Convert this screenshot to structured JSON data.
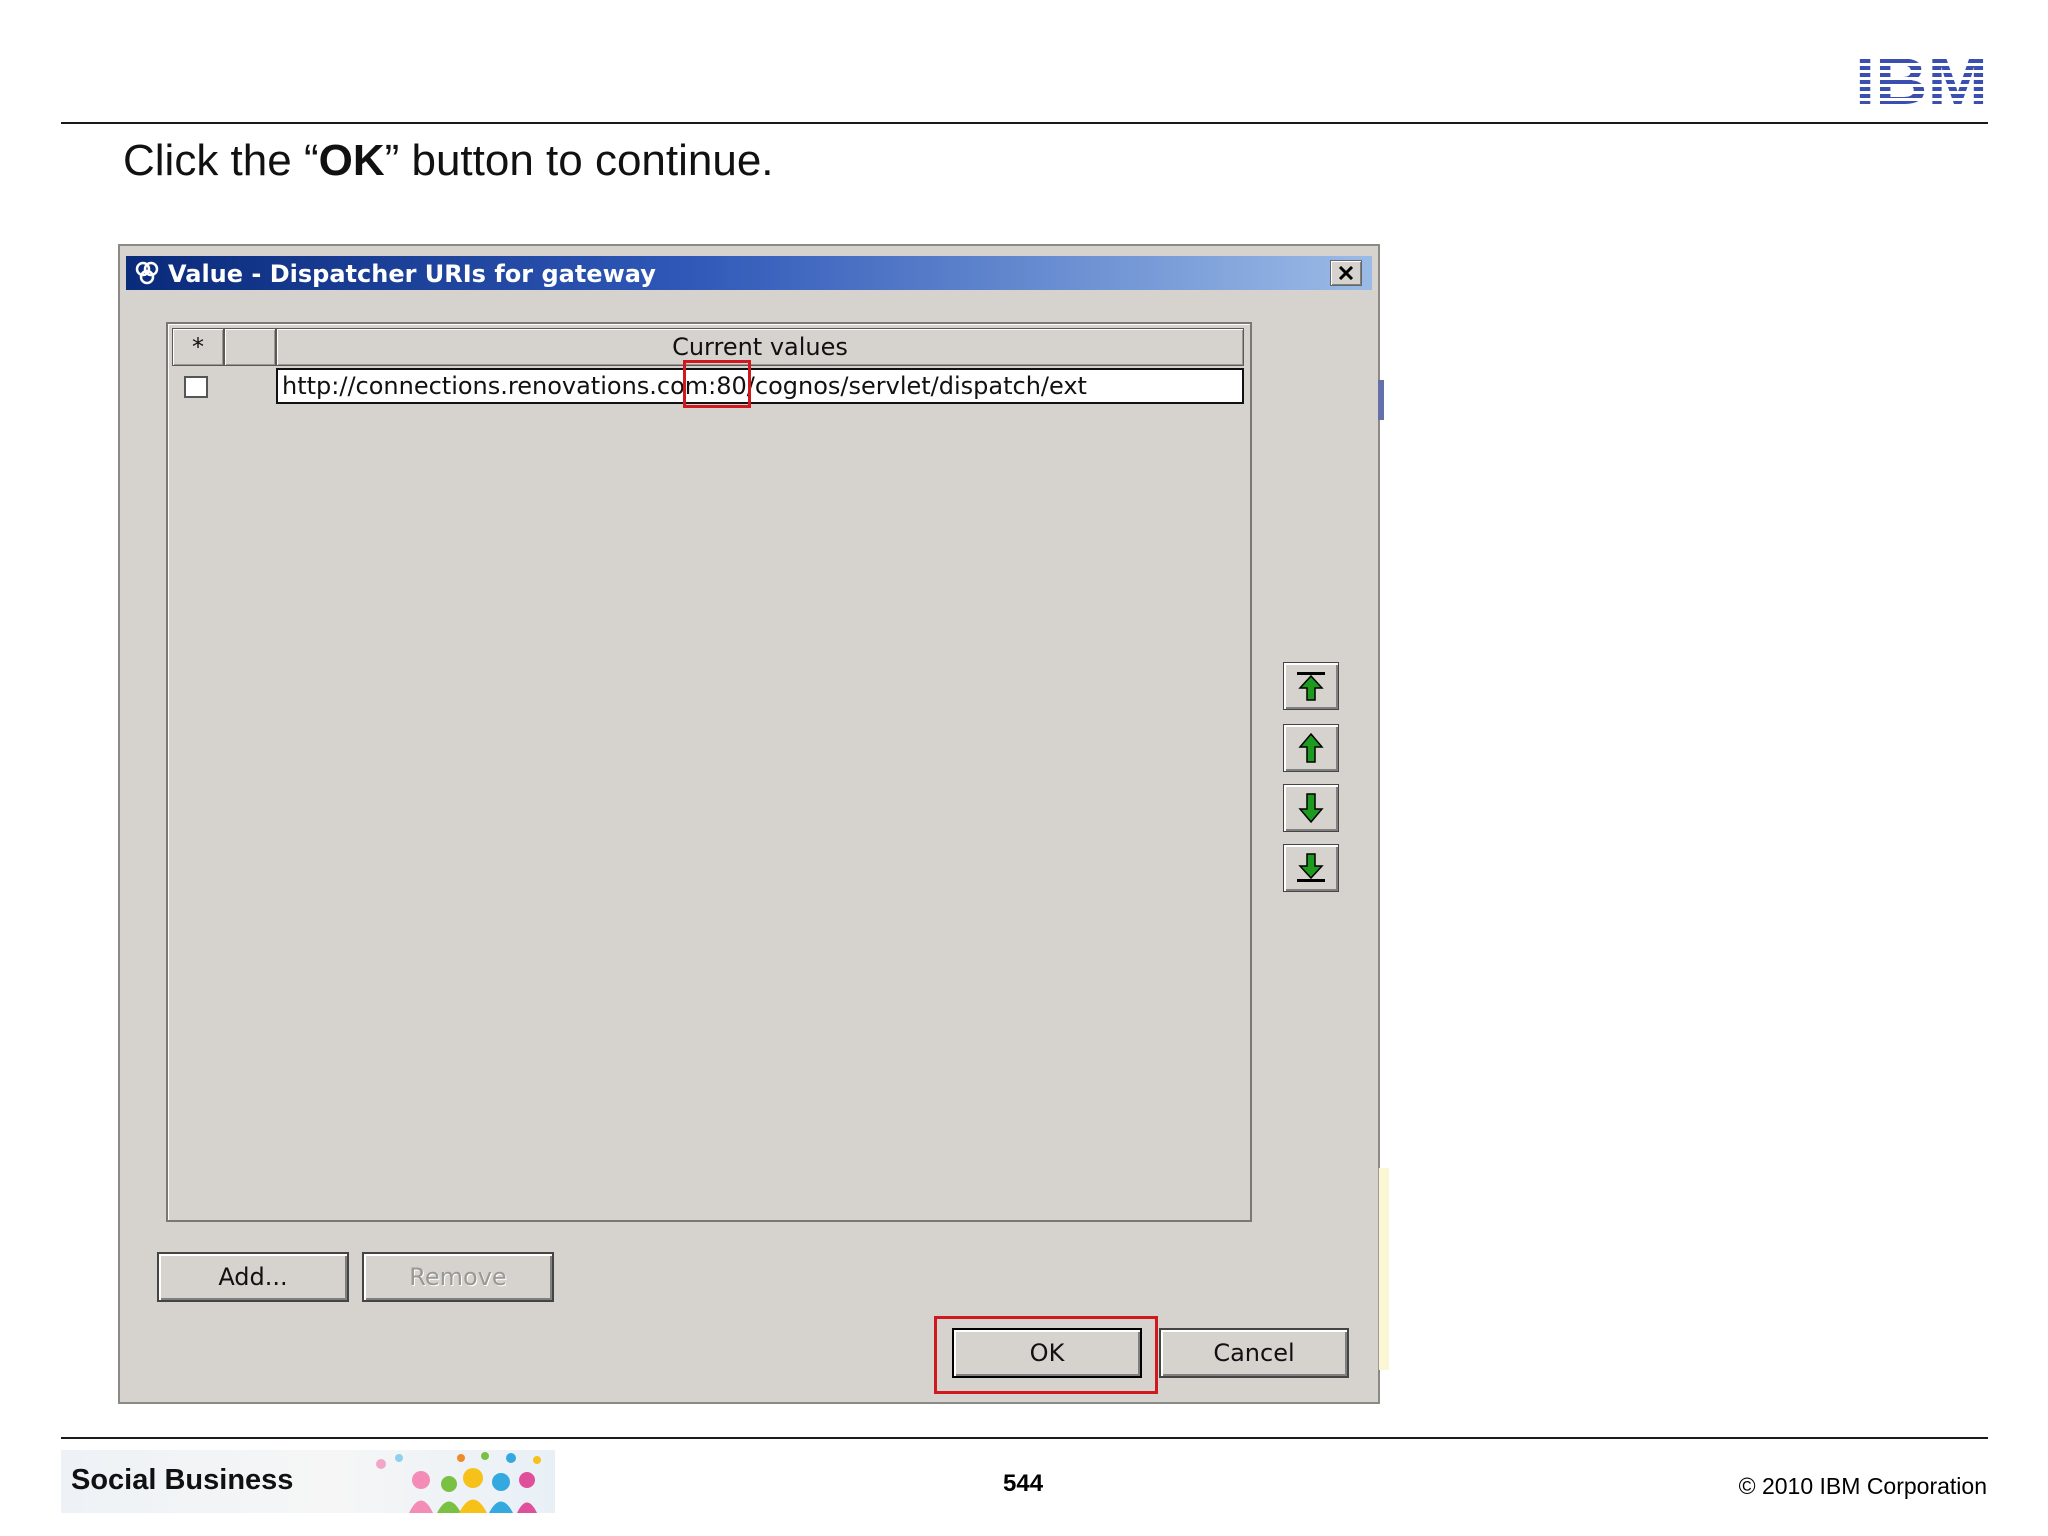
{
  "slide": {
    "instruction_prefix": "Click the “",
    "instruction_bold": "OK",
    "instruction_suffix": "” button to continue.",
    "logo_text": "IBM",
    "footer_brand": "Social Business",
    "page_number": "544",
    "copyright": "© 2010 IBM Corporation"
  },
  "dialog": {
    "title": "Value - Dispatcher URIs for gateway",
    "table": {
      "headers": {
        "marker": "*",
        "blank": "",
        "values": "Current values"
      },
      "rows": [
        {
          "checked": false,
          "value": "http://connections.renovations.com:80/cognos/servlet/dispatch/ext"
        }
      ],
      "highlighted_text": ":80"
    },
    "order_buttons": [
      {
        "name": "move-to-top",
        "icon": "arrow-top-icon"
      },
      {
        "name": "move-up",
        "icon": "arrow-up-icon"
      },
      {
        "name": "move-down",
        "icon": "arrow-down-icon"
      },
      {
        "name": "move-to-bottom",
        "icon": "arrow-bottom-icon"
      }
    ],
    "buttons": {
      "add": "Add...",
      "remove": "Remove",
      "ok": "OK",
      "cancel": "Cancel"
    },
    "remove_enabled": false
  },
  "colors": {
    "highlight": "#d0181f",
    "ibm_blue": "#3a4fb0",
    "arrow_green": "#1e9a1e"
  }
}
